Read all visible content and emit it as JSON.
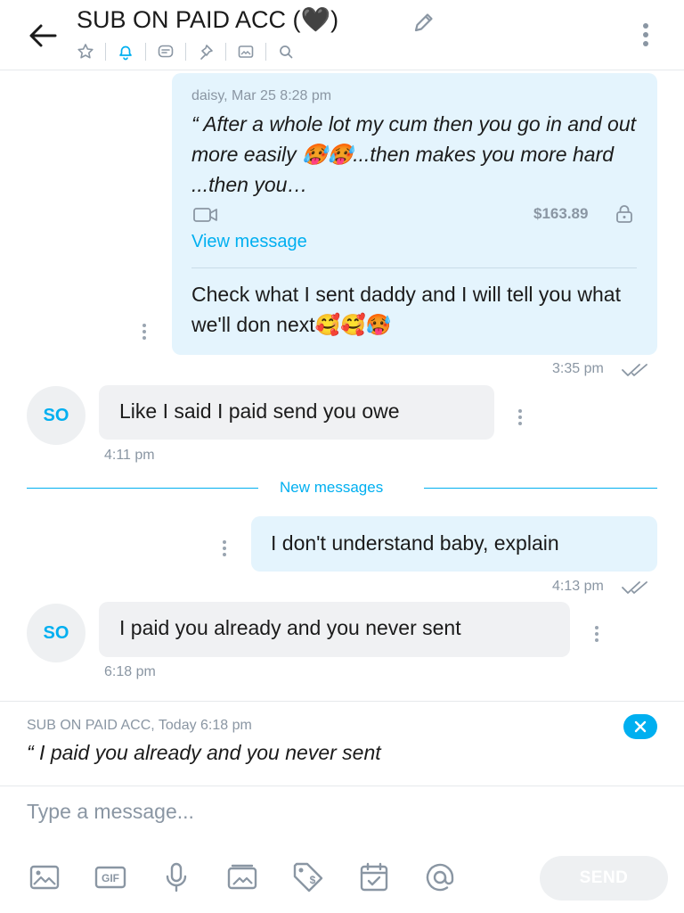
{
  "header": {
    "title": "SUB ON PAID ACC (🖤)",
    "icons": [
      "star-icon",
      "bell-icon",
      "message-icon",
      "pin-icon",
      "image-icon",
      "search-icon"
    ]
  },
  "messages": {
    "m1": {
      "quote_meta": "daisy, Mar 25 8:28 pm",
      "quote_text": "“ After a whole lot my cum then you go in and out more easily 🥵🥵...then makes you more hard ...then you…",
      "price": "$163.89",
      "view_label": "View message",
      "text": "Check what I sent daddy and I will tell you what we'll don next🥰🥰🥵",
      "time": "3:35 pm"
    },
    "m2": {
      "avatar": "SO",
      "text": "Like I said I paid send you owe",
      "time": "4:11 pm"
    },
    "divider": "New messages",
    "m3": {
      "text": "I don't understand baby, explain",
      "time": "4:13 pm"
    },
    "m4": {
      "avatar": "SO",
      "text": "I paid you already and you never sent",
      "time": "6:18 pm"
    }
  },
  "reply": {
    "meta": "SUB ON PAID ACC, Today 6:18 pm",
    "text": "“ I paid you already and you never sent"
  },
  "composer": {
    "placeholder": "Type a message...",
    "send_label": "SEND",
    "tools": [
      "image-icon",
      "gif-icon",
      "microphone-icon",
      "vault-icon",
      "price-tag-icon",
      "schedule-icon",
      "mention-icon"
    ]
  },
  "colors": {
    "accent": "#00aff0",
    "bubble_out": "#e4f4fd",
    "bubble_in": "#f0f1f3",
    "muted": "#8a96a3"
  }
}
